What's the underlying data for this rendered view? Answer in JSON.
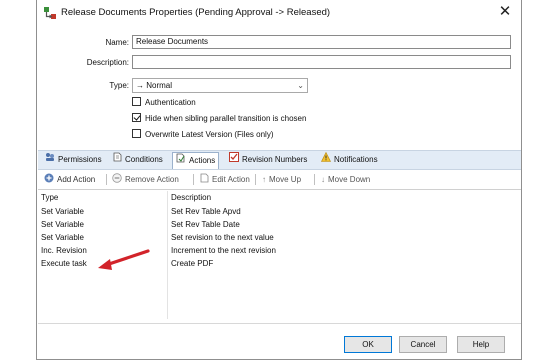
{
  "window": {
    "title": "Release Documents Properties (Pending Approval -> Released)",
    "close_glyph": "✕"
  },
  "form": {
    "name_label": "Name:",
    "name_value": "Release Documents",
    "description_label": "Description:",
    "description_value": "",
    "type_label": "Type:",
    "type_value": "→ Normal",
    "checkboxes": [
      {
        "label": "Authentication",
        "checked": false
      },
      {
        "label": "Hide when sibling parallel transition is chosen",
        "checked": true
      },
      {
        "label": "Overwrite Latest Version (Files only)",
        "checked": false
      }
    ]
  },
  "tabs": [
    {
      "label": "Permissions",
      "icon": "permissions-icon",
      "active": false
    },
    {
      "label": "Conditions",
      "icon": "conditions-icon",
      "active": false
    },
    {
      "label": "Actions",
      "icon": "actions-icon",
      "active": true
    },
    {
      "label": "Revision Numbers",
      "icon": "revision-numbers-icon",
      "active": false
    },
    {
      "label": "Notifications",
      "icon": "notifications-icon",
      "active": false
    }
  ],
  "toolbar": {
    "add_action": "Add Action",
    "remove_action": "Remove Action",
    "edit_action": "Edit Action",
    "move_up": "Move Up",
    "move_down": "Move Down"
  },
  "table": {
    "columns": [
      "Type",
      "Description"
    ],
    "rows": [
      {
        "type": "Set Variable",
        "description": "Set Rev Table Apvd"
      },
      {
        "type": "Set Variable",
        "description": "Set Rev Table Date"
      },
      {
        "type": "Set Variable",
        "description": "Set revision to the next value"
      },
      {
        "type": "Inc. Revision",
        "description": "Increment to the next revision"
      },
      {
        "type": "Execute task",
        "description": "Create PDF"
      }
    ]
  },
  "buttons": {
    "ok": "OK",
    "cancel": "Cancel",
    "help": "Help"
  },
  "colors": {
    "accent": "#0078d7",
    "annotation_arrow": "#d2232a",
    "tab_bar": "#e3ecf6"
  }
}
